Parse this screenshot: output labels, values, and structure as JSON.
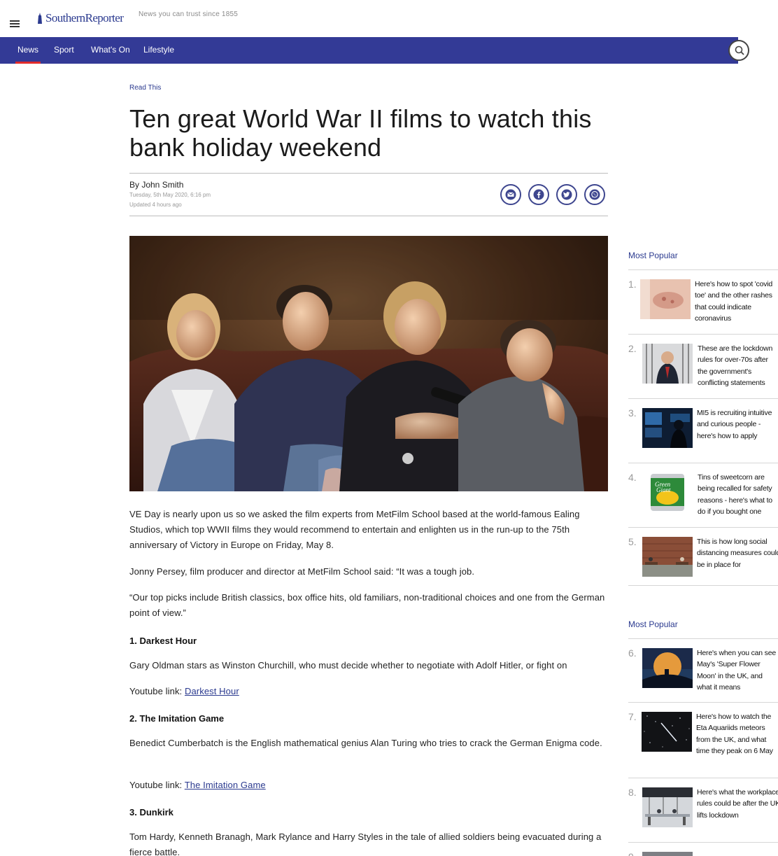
{
  "header": {
    "logo_text": "SouthernReporter",
    "tagline": "News you can trust since 1855"
  },
  "nav": {
    "items": [
      "News",
      "Sport",
      "What's On",
      "Lifestyle"
    ],
    "active": "News"
  },
  "article": {
    "section": "Read This",
    "title": "Ten great World War II films to watch this bank holiday weekend",
    "byline": "By John Smith",
    "date": "Tuesday, 5th May 2020, 6:16 pm",
    "updated": "Updated  4 hours ago",
    "share_icons": [
      "mail-icon",
      "facebook-icon",
      "twitter-icon",
      "whatsapp-icon"
    ],
    "hero_alt": "Family of four watching television on a brown leather sofa",
    "paragraphs": {
      "p1": "VE Day is nearly upon us so we asked the film experts from MetFilm School based at the world-famous Ealing Studios, which top WWII films they would recommend to entertain and enlighten us in the run-up to the 75th anniversary of Victory in Europe on Friday, May 8.",
      "p2": "Jonny Persey, film producer and director at MetFilm School said: “It was a tough job.",
      "p3": "“Our top picks include British classics, box office hits, old familiars, non-traditional choices and one from the German point of view.”",
      "h1": "1. Darkest Hour",
      "p4": "Gary Oldman stars as Winston Churchill, who must decide whether to negotiate with Adolf Hitler, or fight on",
      "link_prefix": "Youtube link: ",
      "link1": "Darkest Hour",
      "h2": "2. The Imitation Game",
      "p5": "Benedict Cumberbatch is the English mathematical genius Alan Turing who tries to crack the German Enigma code.",
      "link2": "The Imitation Game",
      "h3": "3. Dunkirk",
      "p6": "Tom Hardy, Kenneth Branagh, Mark Rylance and Harry Styles in the tale of allied soldiers being evacuated during a fierce battle."
    }
  },
  "sidebar": {
    "block1_title": "Most Popular",
    "block2_title": "Most Popular",
    "items": [
      {
        "num": "1.",
        "text": "Here's how to spot 'covid toe' and the other rashes that could indicate coronavirus"
      },
      {
        "num": "2.",
        "text": "These are the lockdown rules for over-70s after the government's conflicting statements"
      },
      {
        "num": "3.",
        "text": "MI5 is recruiting intuitive and curious people - here's how to apply"
      },
      {
        "num": "4.",
        "text": "Tins of sweetcorn are being recalled for safety reasons - here's what to do if you bought one"
      },
      {
        "num": "5.",
        "text": "This is how long social distancing measures could be in place for"
      },
      {
        "num": "6.",
        "text": "Here's when you can see May's 'Super Flower Moon' in the UK, and what it means"
      },
      {
        "num": "7.",
        "text": "Here's how to watch the Eta Aquariids meteors from the UK, and what time they peak on 6 May"
      },
      {
        "num": "8.",
        "text": "Here's what the workplace rules could be after the UK lifts lockdown"
      }
    ]
  },
  "colors": {
    "nav_bg": "#333a96",
    "nav_active_underline": "#e12b2b",
    "brand": "#2b3a8f"
  }
}
